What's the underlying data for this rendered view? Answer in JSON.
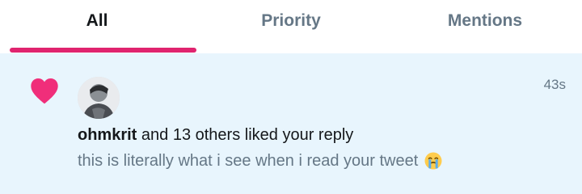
{
  "tabs": [
    {
      "label": "All",
      "active": true
    },
    {
      "label": "Priority",
      "active": false
    },
    {
      "label": "Mentions",
      "active": false
    }
  ],
  "accent_color": "#e0246f",
  "notification": {
    "icon": "heart-icon",
    "timestamp": "43s",
    "username": "ohmkrit",
    "action_text": " and 13 others liked your reply",
    "tweet_text": "this is literally what i see when i read your tweet",
    "emoji": "loudly-crying-face-icon"
  }
}
